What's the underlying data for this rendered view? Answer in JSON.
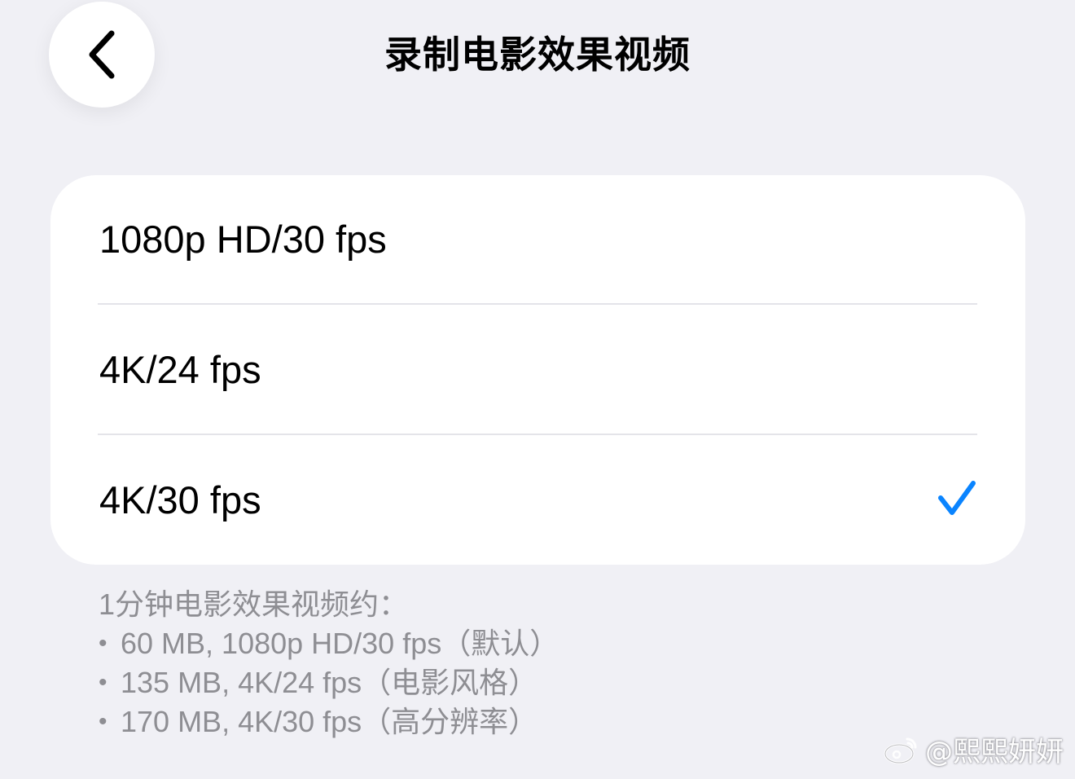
{
  "nav": {
    "title": "录制电影效果视频",
    "back_icon": "chevron-left-icon"
  },
  "options": [
    {
      "label": "1080p HD/30 fps",
      "selected": false
    },
    {
      "label": "4K/24 fps",
      "selected": false
    },
    {
      "label": "4K/30 fps",
      "selected": true
    }
  ],
  "footer": {
    "heading": "1分钟电影效果视频约：",
    "bullet": "•",
    "lines": [
      "60 MB, 1080p HD/30 fps（默认）",
      "135 MB, 4K/24 fps（电影风格）",
      "170 MB, 4K/30 fps（高分辨率）"
    ]
  },
  "watermark": {
    "text": "@熙熙妍妍",
    "icon": "weibo-logo-icon"
  },
  "colors": {
    "background": "#f0f0f5",
    "card": "#ffffff",
    "accent": "#0a84ff",
    "secondary_text": "#8e8e93"
  }
}
